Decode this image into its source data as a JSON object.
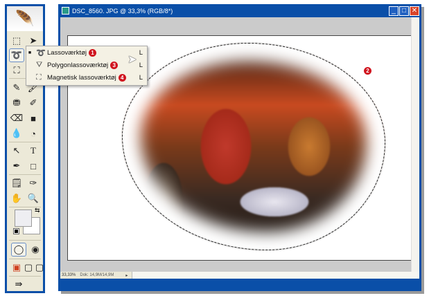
{
  "window": {
    "title": "DSC_8560. JPG @ 33,3% (RGB/8*)",
    "minimize": "_",
    "maximize": "□",
    "close": "✕"
  },
  "status": {
    "zoom": "33,33%",
    "doc": "Dok: 14,9M/14,9M"
  },
  "menu": {
    "items": [
      {
        "label": "Lassoværktøj",
        "shortcut": "L",
        "badge": "1",
        "checked": "■"
      },
      {
        "label": "Polygonlassoværktøj",
        "shortcut": "L",
        "badge": "3",
        "checked": ""
      },
      {
        "label": "Magnetisk lassoværktøj",
        "shortcut": "L",
        "badge": "4",
        "checked": ""
      }
    ]
  },
  "canvas_badge": "2",
  "colors": {
    "accent": "#0a4fa8",
    "badge": "#d0141e"
  }
}
